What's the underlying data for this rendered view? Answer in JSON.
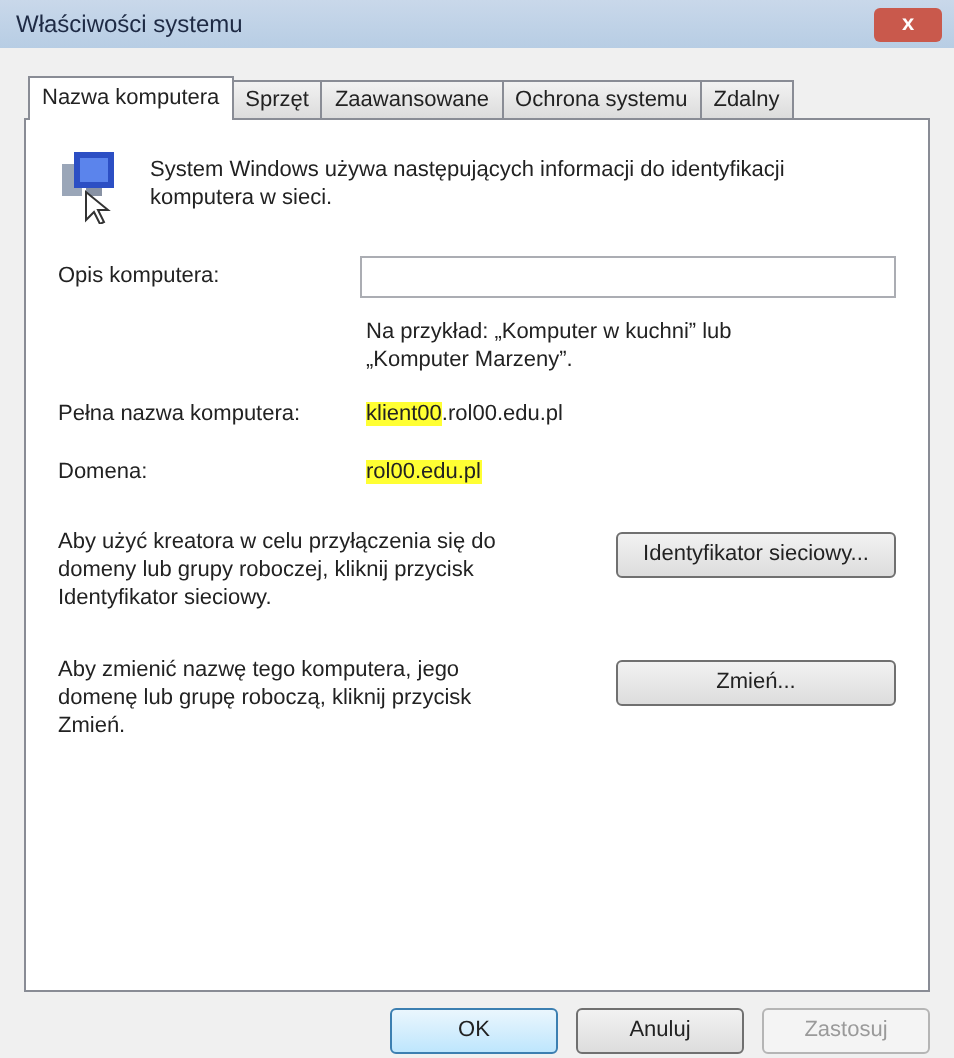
{
  "window": {
    "title": "Właściwości systemu",
    "close": "x"
  },
  "tabs": [
    {
      "label": "Nazwa komputera",
      "selected": true
    },
    {
      "label": "Sprzęt",
      "selected": false
    },
    {
      "label": "Zaawansowane",
      "selected": false
    },
    {
      "label": "Ochrona systemu",
      "selected": false
    },
    {
      "label": "Zdalny",
      "selected": false
    }
  ],
  "intro": "System Windows używa następujących informacji do identyfikacji komputera w sieci.",
  "description": {
    "label": "Opis komputera:"
  },
  "example": "Na przykład: „Komputer w kuchni” lub „Komputer Marzeny”.",
  "info_rows": [
    {
      "label": "Pełna nazwa komputera:",
      "parts": [
        {
          "text": "klient00",
          "highlighted": true
        },
        {
          "text": ".rol00.edu.pl",
          "highlighted": false
        }
      ]
    },
    {
      "label": "Domena:",
      "parts": [
        {
          "text": "rol00.edu.pl",
          "highlighted": true
        }
      ]
    }
  ],
  "actions": [
    {
      "text": "Aby użyć kreatora w celu przyłączenia się do domeny lub grupy roboczej, kliknij przycisk Identyfikator sieciowy.",
      "button": "Identyfikator sieciowy..."
    },
    {
      "text": "Aby zmienić nazwę tego komputera, jego domenę lub grupę roboczą, kliknij przycisk Zmień.",
      "button": "Zmień..."
    }
  ],
  "buttons": [
    {
      "label": "OK",
      "default": true,
      "disabled": false
    },
    {
      "label": "Anuluj",
      "default": false,
      "disabled": false
    },
    {
      "label": "Zastosuj",
      "default": false,
      "disabled": true
    }
  ]
}
